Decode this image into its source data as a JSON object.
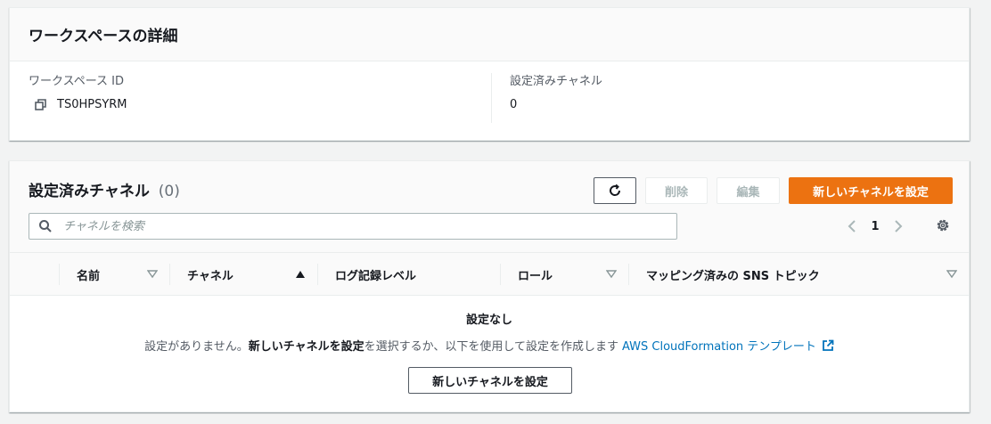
{
  "details": {
    "title": "ワークスペースの詳細",
    "workspace_id_label": "ワークスペース ID",
    "workspace_id_value": "TS0HPSYRM",
    "configured_channels_label": "設定済みチャネル",
    "configured_channels_value": "0"
  },
  "channels": {
    "title": "設定済みチャネル",
    "count": "(0)",
    "buttons": {
      "delete": "削除",
      "edit": "編集",
      "configure_new": "新しいチャネルを設定"
    },
    "search": {
      "placeholder": "チャネルを検索",
      "value": ""
    },
    "pagination": {
      "current_page": "1"
    },
    "columns": [
      {
        "label": "名前",
        "sort": "none"
      },
      {
        "label": "チャネル",
        "sort": "ascending"
      },
      {
        "label": "ログ記録レベル",
        "sort": null
      },
      {
        "label": "ロール",
        "sort": "none"
      },
      {
        "label": "マッピング済みの SNS トピック",
        "sort": "none"
      }
    ],
    "empty_state": {
      "title": "設定なし",
      "desc_prefix": "設定がありません。",
      "desc_strong": "新しいチャネルを設定",
      "desc_middle": " を選択するか、以下を使用して設定を作成します",
      "desc_link": "AWS CloudFormation テンプレート",
      "button_label": "新しいチャネルを設定"
    }
  },
  "colors": {
    "primary": "#ec7211",
    "link": "#0073bb",
    "background": "#f2f3f3"
  }
}
